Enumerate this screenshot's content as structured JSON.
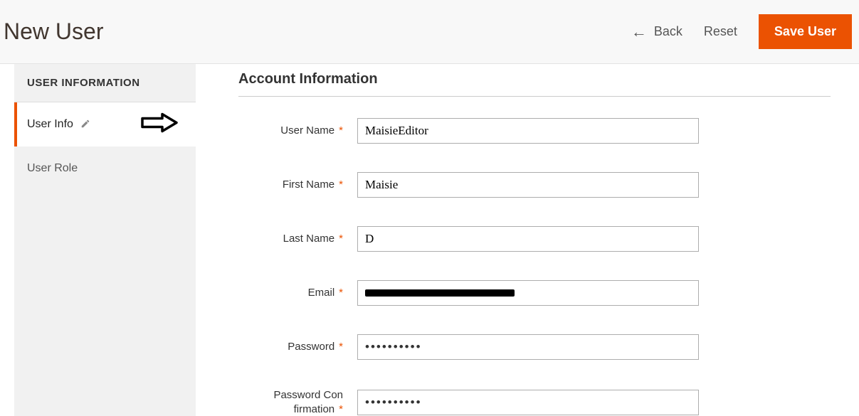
{
  "header": {
    "title": "New User",
    "back_label": "Back",
    "reset_label": "Reset",
    "save_label": "Save User"
  },
  "sidebar": {
    "heading": "USER INFORMATION",
    "items": [
      {
        "label": "User Info",
        "active": true
      },
      {
        "label": "User Role",
        "active": false
      }
    ]
  },
  "section": {
    "title": "Account Information"
  },
  "form": {
    "username_label": "User Name",
    "username_value": "MaisieEditor",
    "firstname_label": "First Name",
    "firstname_value": "Maisie",
    "lastname_label": "Last Name",
    "lastname_value": "D",
    "email_label": "Email",
    "email_value": "",
    "password_label": "Password",
    "password_value": "••••••••••",
    "password_conf_label": "Password Con firmation",
    "password_conf_value": "••••••••••"
  }
}
